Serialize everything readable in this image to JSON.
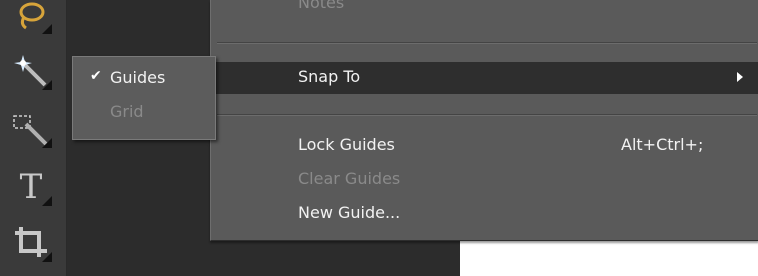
{
  "toolbar": {
    "tools": [
      {
        "icon": "lasso-icon"
      },
      {
        "icon": "magic-wand-icon"
      },
      {
        "icon": "quick-selection-icon"
      },
      {
        "icon": "type-tool-icon",
        "glyph": "T"
      },
      {
        "icon": "crop-tool-icon"
      }
    ]
  },
  "menu": {
    "partial_item_label": "Notes",
    "items": [
      {
        "label": "Snap To",
        "shortcut": "",
        "state": "highlighted",
        "has_submenu": true
      },
      {
        "label": "Lock Guides",
        "shortcut": "Alt+Ctrl+;",
        "state": "enabled"
      },
      {
        "label": "Clear Guides",
        "shortcut": "",
        "state": "disabled"
      },
      {
        "label": "New Guide...",
        "shortcut": "",
        "state": "enabled"
      }
    ]
  },
  "submenu": {
    "items": [
      {
        "label": "Guides",
        "checked": true,
        "state": "enabled"
      },
      {
        "label": "Grid",
        "checked": false,
        "state": "disabled"
      }
    ],
    "check_glyph": "✔"
  },
  "colors": {
    "menu_bg": "#5a5a5a",
    "highlight_bg": "#2e2e2e",
    "text": "#f2f2f2",
    "disabled_text": "#8a8a8a",
    "toolbar_bg": "#3a3a3a",
    "workspace_bg": "#2c2c2c"
  }
}
